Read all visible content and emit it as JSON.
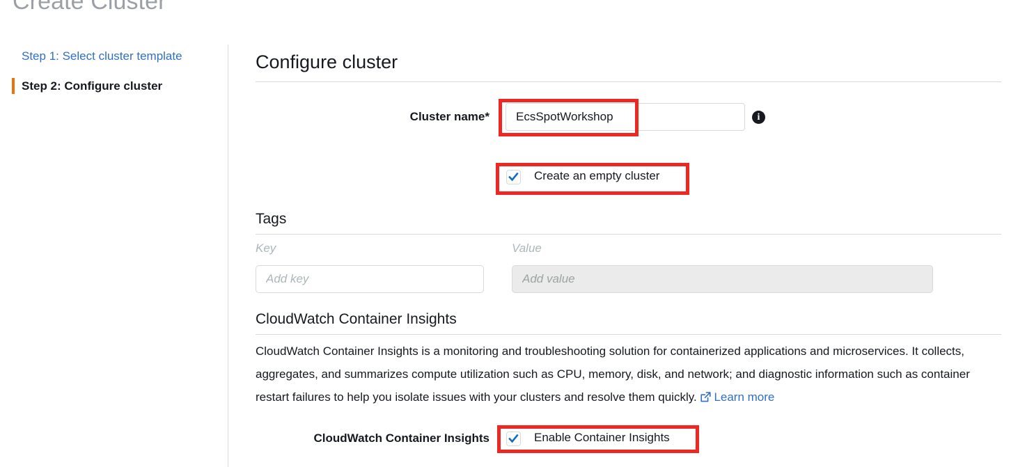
{
  "page": {
    "title": "Create Cluster"
  },
  "sidebar": {
    "steps": [
      {
        "label": "Step 1: Select cluster template",
        "state": "completed"
      },
      {
        "label": "Step 2: Configure cluster",
        "state": "current"
      }
    ]
  },
  "main": {
    "heading": "Configure cluster",
    "cluster_name": {
      "label": "Cluster name*",
      "value": "EcsSpotWorkshop",
      "placeholder": "",
      "info_icon": "info-icon",
      "info_glyph": "i"
    },
    "empty_cluster": {
      "label": "Create an empty cluster",
      "checked": true
    },
    "tags": {
      "heading": "Tags",
      "key_column_label": "Key",
      "value_column_label": "Value",
      "key_placeholder": "Add key",
      "key_value": "",
      "value_placeholder": "Add value",
      "value_value": "",
      "value_disabled": true
    },
    "container_insights": {
      "heading": "CloudWatch Container Insights",
      "description": "CloudWatch Container Insights is a monitoring and troubleshooting solution for containerized applications and microservices. It collects, aggregates, and summarizes compute utilization such as CPU, memory, disk, and network; and diagnostic information such as container restart failures to help you isolate issues with your clusters and resolve them quickly.",
      "learn_more": "Learn more",
      "learn_more_icon": "external-link-icon",
      "row_label": "CloudWatch Container Insights",
      "checkbox_label": "Enable Container Insights",
      "checked": true
    }
  },
  "annotations": {
    "highlight_color": "#ee2722",
    "boxes": [
      "cluster-name-field",
      "create-empty-cluster-checkbox",
      "enable-container-insights-checkbox"
    ]
  },
  "colors": {
    "link": "#2f6fc5",
    "current_step_marker": "#ec7211",
    "checkbox_check": "#0f6cbd",
    "title_gray": "#9aa0a6",
    "divider": "#d5dbdb",
    "disabled_field_bg": "#ebebeb"
  }
}
